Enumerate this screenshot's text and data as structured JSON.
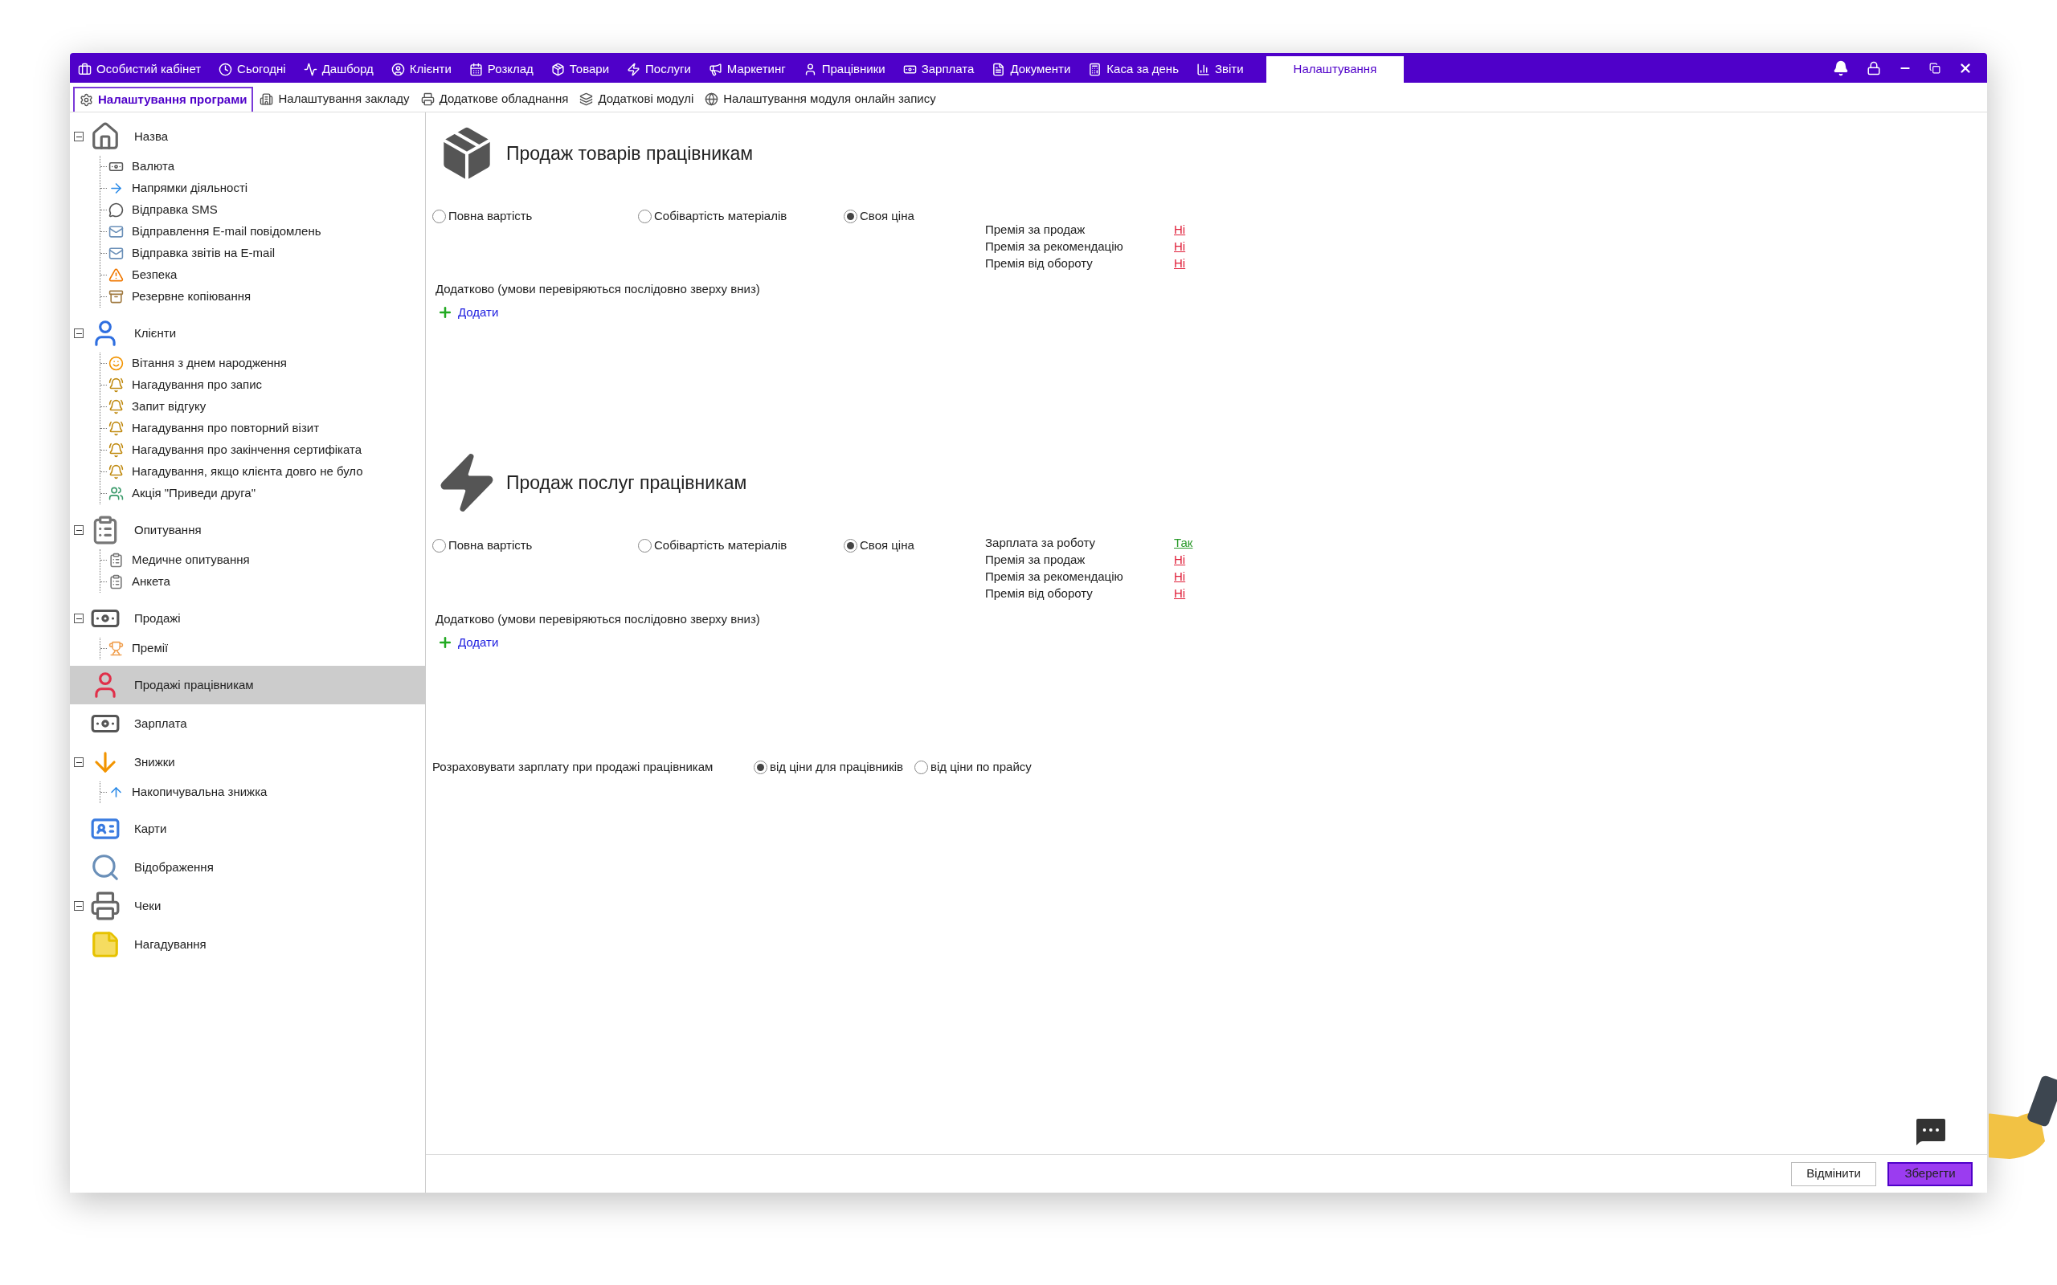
{
  "top_tabs": [
    {
      "label": "Особистий кабінет",
      "selected": false
    },
    {
      "label": "Сьогодні",
      "selected": false
    },
    {
      "label": "Дашборд",
      "selected": false
    },
    {
      "label": "Клієнти",
      "selected": false
    },
    {
      "label": "Розклад",
      "selected": false
    },
    {
      "label": "Товари",
      "selected": false
    },
    {
      "label": "Послуги",
      "selected": false
    },
    {
      "label": "Маркетинг",
      "selected": false
    },
    {
      "label": "Працівники",
      "selected": false
    },
    {
      "label": "Зарплата",
      "selected": false
    },
    {
      "label": "Документи",
      "selected": false
    },
    {
      "label": "Каса за день",
      "selected": false
    },
    {
      "label": "Звіти",
      "selected": false
    },
    {
      "label": "Налаштування",
      "selected": true
    }
  ],
  "sub_tabs": [
    {
      "label": "Налаштування програми",
      "selected": true
    },
    {
      "label": "Налаштування закладу",
      "selected": false
    },
    {
      "label": "Додаткове обладнання",
      "selected": false
    },
    {
      "label": "Додаткові модулі",
      "selected": false
    },
    {
      "label": "Налаштування модуля онлайн запису",
      "selected": false
    }
  ],
  "tree": [
    {
      "label": "Назва",
      "expanded": true,
      "selected": false,
      "children": [
        {
          "label": "Валюта"
        },
        {
          "label": "Напрямки діяльності"
        },
        {
          "label": "Відправка SMS"
        },
        {
          "label": "Відправлення E-mail повідомлень"
        },
        {
          "label": "Відправка звітів на E-mail"
        },
        {
          "label": "Безпека"
        },
        {
          "label": "Резервне копіювання"
        }
      ]
    },
    {
      "label": "Клієнти",
      "expanded": true,
      "selected": false,
      "children": [
        {
          "label": "Вітання з днем народження"
        },
        {
          "label": "Нагадування про запис"
        },
        {
          "label": "Запит відгуку"
        },
        {
          "label": "Нагадування про повторний візит"
        },
        {
          "label": "Нагадування про закінчення сертифіката"
        },
        {
          "label": "Нагадування, якщо клієнта довго не було"
        },
        {
          "label": "Акція \"Приведи друга\""
        }
      ]
    },
    {
      "label": "Опитування",
      "expanded": true,
      "selected": false,
      "children": [
        {
          "label": "Медичне опитування"
        },
        {
          "label": "Анкета"
        }
      ]
    },
    {
      "label": "Продажі",
      "expanded": true,
      "selected": false,
      "children": [
        {
          "label": "Премії"
        }
      ]
    },
    {
      "label": "Продажі працівникам",
      "selected": true
    },
    {
      "label": "Зарплата",
      "selected": false
    },
    {
      "label": "Знижки",
      "expanded": true,
      "selected": false,
      "children": [
        {
          "label": "Накопичувальна знижка"
        }
      ]
    },
    {
      "label": "Карти",
      "selected": false
    },
    {
      "label": "Відображення",
      "selected": false
    },
    {
      "label": "Чеки",
      "expanded": true,
      "selected": false
    },
    {
      "label": "Нагадування",
      "selected": false
    }
  ],
  "sections": [
    {
      "kind": "goods",
      "title": "Продаж товарів працівникам",
      "options": [
        {
          "label": "Повна вартість",
          "selected": false
        },
        {
          "label": "Собівартість матеріалів",
          "selected": false
        },
        {
          "label": "Своя ціна",
          "selected": true
        }
      ],
      "settings": [
        {
          "label": "Премія за продаж",
          "value": "Ні",
          "on": false
        },
        {
          "label": "Премія за рекомендацію",
          "value": "Ні",
          "on": false
        },
        {
          "label": "Премія від обороту",
          "value": "Ні",
          "on": false
        }
      ],
      "extra_label": "Додатково (умови перевіряються послідовно зверху вниз)",
      "add_link": "Додати"
    },
    {
      "kind": "services",
      "title": "Продаж послуг працівникам",
      "options": [
        {
          "label": "Повна вартість",
          "selected": false
        },
        {
          "label": "Собівартість матеріалів",
          "selected": false
        },
        {
          "label": "Своя ціна",
          "selected": true
        }
      ],
      "settings": [
        {
          "label": "Зарплата за роботу",
          "value": "Так",
          "on": true
        },
        {
          "label": "Премія за продаж",
          "value": "Ні",
          "on": false
        },
        {
          "label": "Премія за рекомендацію",
          "value": "Ні",
          "on": false
        },
        {
          "label": "Премія від обороту",
          "value": "Ні",
          "on": false
        }
      ],
      "extra_label": "Додатково (умови перевіряються послідовно зверху вниз)",
      "add_link": "Додати"
    }
  ],
  "salary_calc": {
    "label": "Розраховувати зарплату при продажі працівникам",
    "options": [
      {
        "label": "від ціни для працівників",
        "selected": true
      },
      {
        "label": "від ціни по прайсу",
        "selected": false
      }
    ]
  },
  "buttons": [
    {
      "label": "Відмінити",
      "kind": "secondary"
    },
    {
      "label": "Зберегти",
      "kind": "primary"
    }
  ]
}
